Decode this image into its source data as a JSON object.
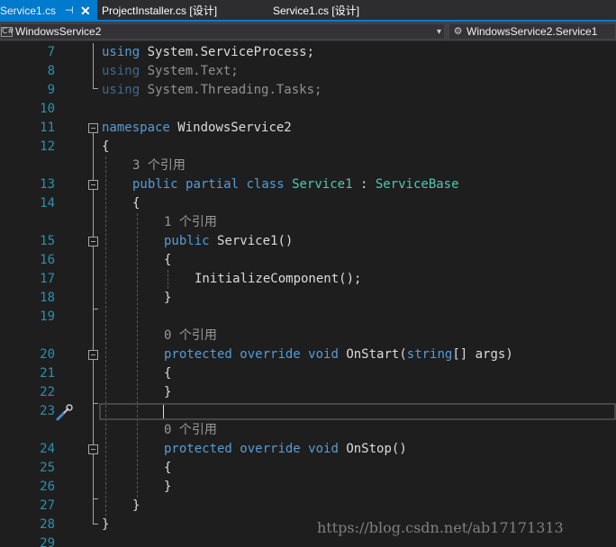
{
  "tabs": [
    {
      "label": "Service1.cs",
      "active": true,
      "pin": "⊣",
      "close": "✕"
    },
    {
      "label": "ProjectInstaller.cs [设计]"
    },
    {
      "label": "Service1.cs [设计]"
    }
  ],
  "navbar": {
    "left_icon": "C#",
    "left_value": "WindowsService2",
    "right_icon": "⚙",
    "right_value": "WindowsService2.Service1",
    "dropdown": "▾"
  },
  "code": {
    "lines": [
      {
        "n": "7"
      },
      {
        "n": "8"
      },
      {
        "n": "9"
      },
      {
        "n": "10"
      },
      {
        "n": "11"
      },
      {
        "n": "12"
      },
      {
        "n": "13"
      },
      {
        "n": "14"
      },
      {
        "n": "15"
      },
      {
        "n": "16"
      },
      {
        "n": "17"
      },
      {
        "n": "18"
      },
      {
        "n": "19"
      },
      {
        "n": "20"
      },
      {
        "n": "21"
      },
      {
        "n": "22"
      },
      {
        "n": "23"
      },
      {
        "n": "24"
      },
      {
        "n": "25"
      },
      {
        "n": "26"
      },
      {
        "n": "27"
      },
      {
        "n": "28"
      },
      {
        "n": "29"
      }
    ],
    "t": {
      "using": "using",
      "ns1": "System.ServiceProcess;",
      "ns2": "System.Text;",
      "ns3": "System.Threading.Tasks;",
      "namespace": "namespace",
      "nsname": "WindowsService2",
      "lbrace": "{",
      "rbrace": "}",
      "ref3": "3 个引用",
      "ref1": "1 个引用",
      "ref0a": "0 个引用",
      "ref0b": "0 个引用",
      "public": "public",
      "partial": "partial",
      "class": "class",
      "classname": "Service1",
      "colon": ":",
      "base": "ServiceBase",
      "ctor": "Service1()",
      "init": "InitializeComponent();",
      "protected": "protected",
      "override": "override",
      "void": "void",
      "onstart": "OnStart(",
      "string": "string",
      "args": "[] args)",
      "onstop": "OnStop()"
    }
  },
  "watermark": "https://blog.csdn.net/ab17171313",
  "colors": {
    "background": "#1e1e1e",
    "keyword": "#569cd6",
    "type": "#4ec9b0",
    "line_number": "#2b91af",
    "tab_active": "#007acc"
  }
}
